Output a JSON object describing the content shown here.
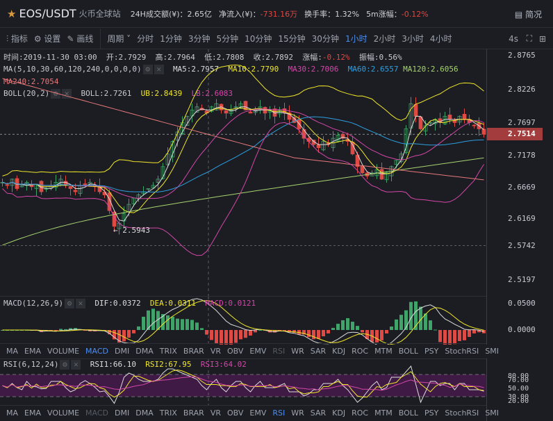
{
  "header": {
    "pair": "EOS/USDT",
    "exchange": "火币全球站",
    "stats": [
      {
        "label": "24H成交额(¥)：",
        "value": "2.65亿"
      },
      {
        "label": "净流入(¥)：",
        "value": "-731.16万",
        "neg": true
      },
      {
        "label": "换手率：",
        "value": "1.32%"
      },
      {
        "label": "5m涨幅：",
        "value": "-0.12%",
        "neg": true
      }
    ],
    "brief": "简况"
  },
  "toolbar": {
    "indicators": "指标",
    "settings": "设置",
    "draw": "画线",
    "period": "周期",
    "intervals": [
      "分时",
      "1分钟",
      "3分钟",
      "5分钟",
      "10分钟",
      "15分钟",
      "30分钟",
      "1小时",
      "2小时",
      "3小时",
      "4小时"
    ],
    "active": "1小时",
    "refresh": "4s"
  },
  "info": {
    "time": "时间:2019-11-30 03:00",
    "open": "开:2.7929",
    "high": "高:2.7964",
    "low": "低:2.7808",
    "close": "收:2.7892",
    "chg_label": "涨幅:",
    "chg": "-0.12%",
    "amp": "振幅:0.56%"
  },
  "ma": {
    "label": "MA(5,10,30,60,120,240,0,0,0,0)",
    "ma5": "MA5:2.7957",
    "ma10": "MA10:2.7790",
    "ma30": "MA30:2.7006",
    "ma60": "MA60:2.6557",
    "ma120": "MA120:2.6056",
    "ma240": "MA240:2.7054"
  },
  "boll": {
    "label": "BOLL(20,2)",
    "boll": "BOLL:2.7261",
    "ub": "UB:2.8439",
    "lb": "LB:2.6083"
  },
  "price_axis": [
    "2.8765",
    "2.8226",
    "2.7697",
    "2.7178",
    "2.6669",
    "2.6169",
    "2.5742",
    "2.5197"
  ],
  "last_price": "2.7514",
  "low_marker": "← 2.5943",
  "macd": {
    "label": "MACD(12,26,9)",
    "dif": "DIF:0.0372",
    "dea": "DEA:0.0311",
    "macd": "MACD:0.0121",
    "axis": [
      "0.0500",
      "0.0000"
    ]
  },
  "rsi": {
    "label": "RSI(6,12,24)",
    "rsi1": "RSI1:66.10",
    "rsi2": "RSI2:67.95",
    "rsi3": "RSI3:64.02",
    "axis": [
      "80.00",
      "70.00",
      "50.00",
      "30.00",
      "20.00"
    ]
  },
  "indicator_tabs": [
    "MA",
    "EMA",
    "VOLUME",
    "MACD",
    "DMI",
    "DMA",
    "TRIX",
    "BRAR",
    "VR",
    "OBV",
    "EMV",
    "RSI",
    "WR",
    "SAR",
    "KDJ",
    "ROC",
    "MTM",
    "BOLL",
    "PSY",
    "StochRSI",
    "SMI"
  ],
  "closes": [
    2.675,
    2.67,
    2.68,
    2.665,
    2.67,
    2.675,
    2.668,
    2.672,
    2.66,
    2.665,
    2.67,
    2.675,
    2.68,
    2.67,
    2.665,
    2.66,
    2.67,
    2.672,
    2.675,
    2.668,
    2.66,
    2.655,
    2.63,
    2.605,
    2.61,
    2.625,
    2.64,
    2.65,
    2.655,
    2.66,
    2.665,
    2.67,
    2.68,
    2.7,
    2.72,
    2.74,
    2.755,
    2.77,
    2.78,
    2.79,
    2.795,
    2.79,
    2.785,
    2.795,
    2.8,
    2.79,
    2.785,
    2.79,
    2.795,
    2.8,
    2.79,
    2.785,
    2.79,
    2.795,
    2.785,
    2.79,
    2.78,
    2.79,
    2.785,
    2.775,
    2.77,
    2.76,
    2.745,
    2.74,
    2.735,
    2.73,
    2.74,
    2.735,
    2.745,
    2.75,
    2.745,
    2.74,
    2.72,
    2.7,
    2.69,
    2.685,
    2.69,
    2.695,
    2.68,
    2.69,
    2.7,
    2.71,
    2.72,
    2.76,
    2.8,
    2.78,
    2.76,
    2.765,
    2.77,
    2.775,
    2.77,
    2.78,
    2.775,
    2.77,
    2.78,
    2.775,
    2.77,
    2.765,
    2.76,
    2.7514
  ]
}
